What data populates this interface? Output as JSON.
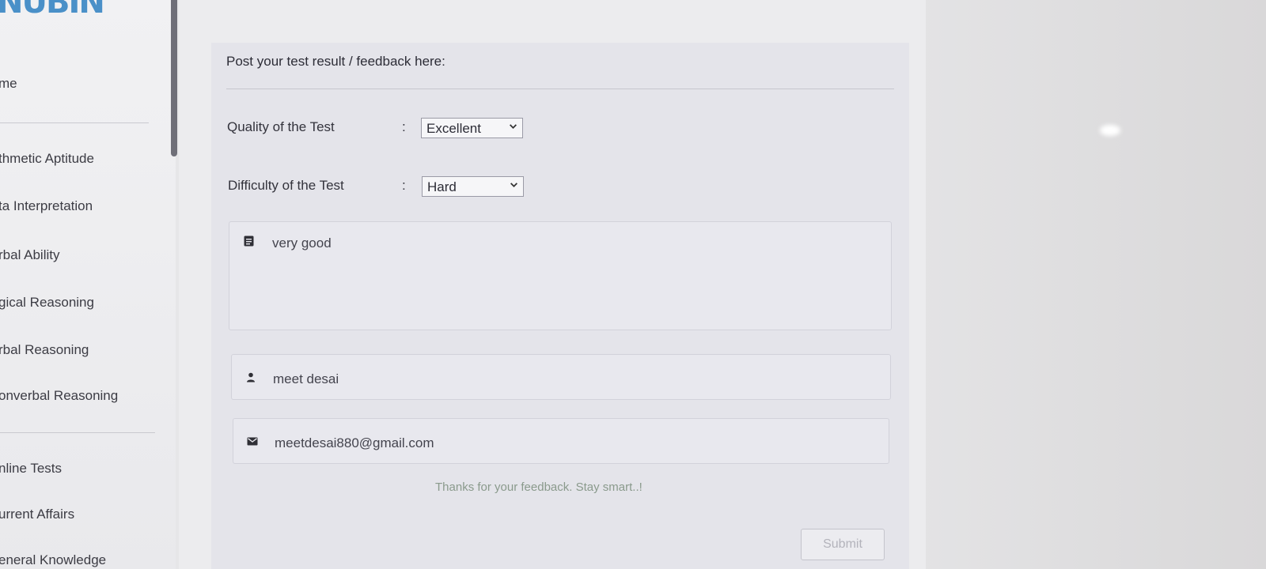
{
  "sidebar": {
    "logo_text": "NUBIN",
    "items": [
      {
        "label": "me"
      },
      {
        "label": "thmetic Aptitude"
      },
      {
        "label": "ta Interpretation"
      },
      {
        "label": "rbal Ability"
      },
      {
        "label": "gical Reasoning"
      },
      {
        "label": "rbal Reasoning"
      },
      {
        "label": "onverbal Reasoning"
      },
      {
        "label": "nline Tests"
      },
      {
        "label": "urrent Affairs"
      },
      {
        "label": "eneral Knowledge"
      }
    ]
  },
  "feedback": {
    "title": "Post your test result / feedback here:",
    "quality_label": "Quality of the Test",
    "quality_value": "Excellent",
    "difficulty_label": "Difficulty of the Test",
    "difficulty_value": "Hard",
    "colon": ":",
    "comment_value": "very good",
    "name_value": "meet desai",
    "email_value": "meetdesai880@gmail.com",
    "thanks_text": "Thanks for your feedback. Stay smart..!",
    "submit_label": "Submit"
  },
  "icons": {
    "comment": "document-icon",
    "name": "user-icon",
    "email": "envelope-icon",
    "select_arrow": "chevron-down-icon"
  },
  "colors": {
    "logo_green": "#5cb85c",
    "logo_blue": "#4a90c8"
  }
}
